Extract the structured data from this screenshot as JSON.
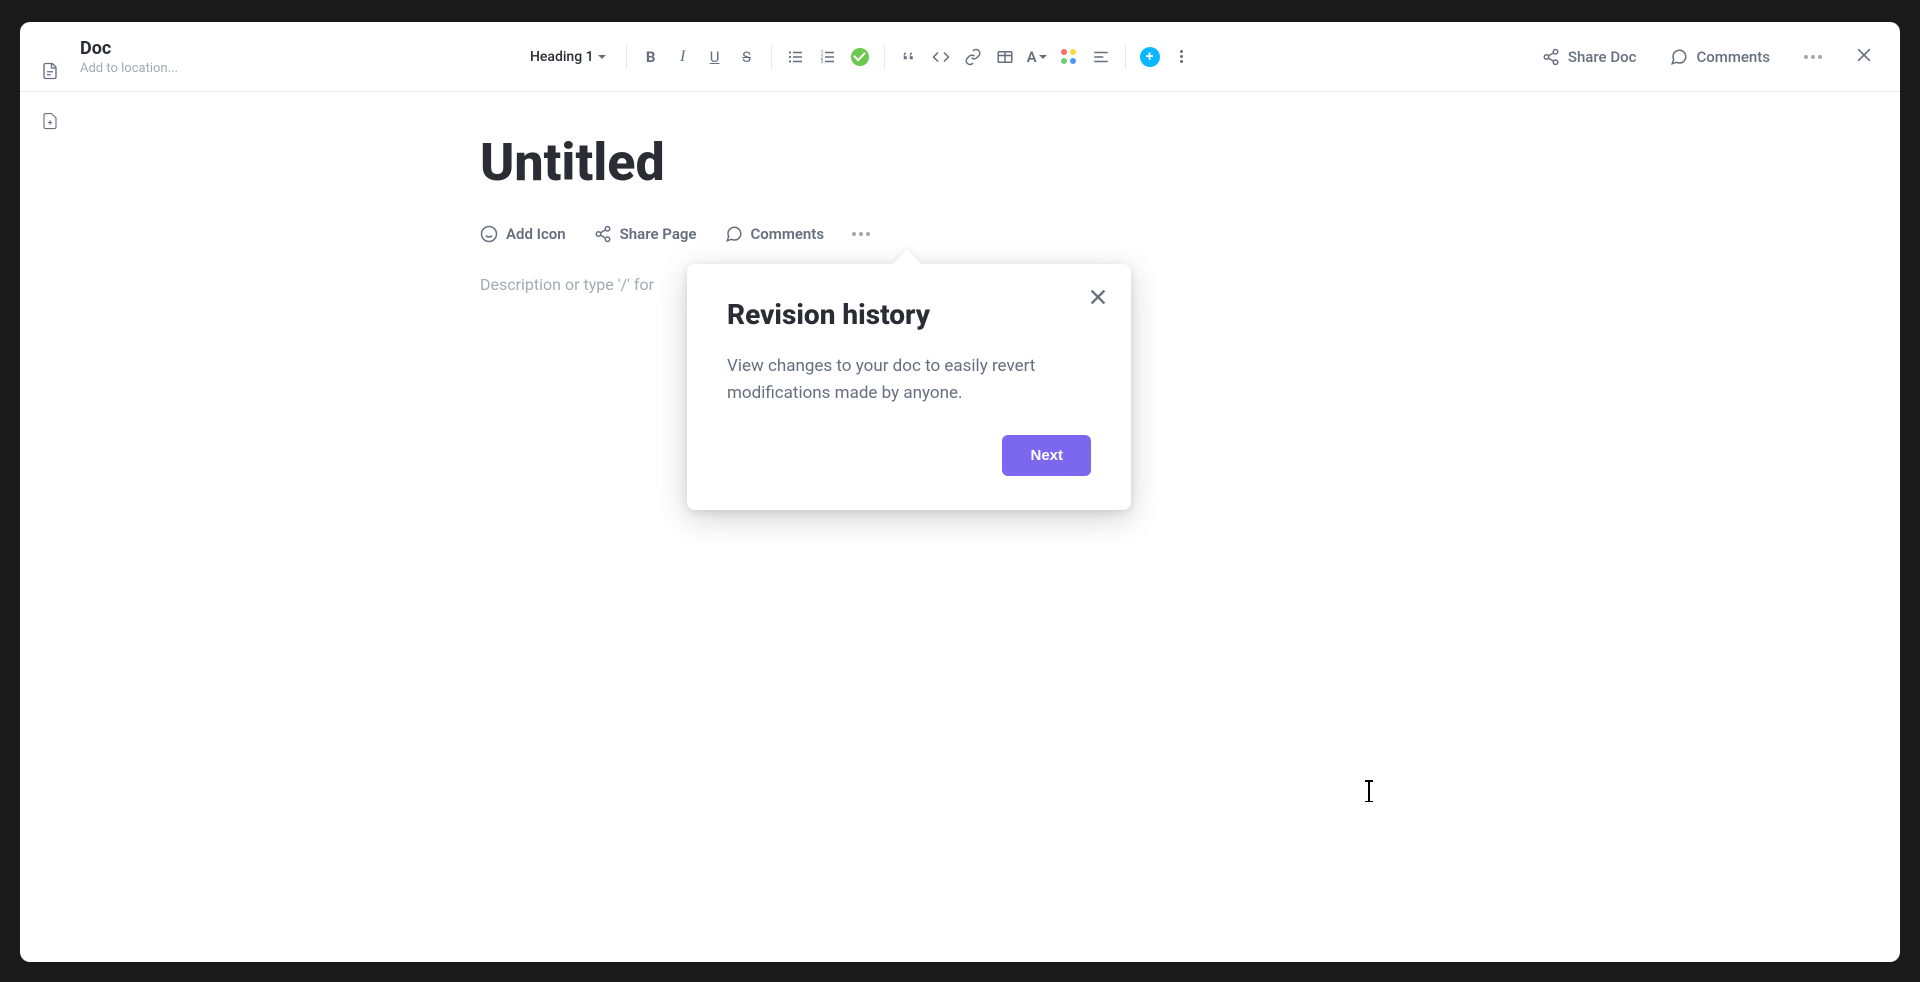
{
  "header": {
    "doc_label": "Doc",
    "location_placeholder": "Add to location...",
    "heading_selector": "Heading 1",
    "share_doc": "Share Doc",
    "comments": "Comments"
  },
  "doc": {
    "title": "Untitled",
    "description_placeholder": "Description or type '/' for"
  },
  "page_actions": {
    "add_icon": "Add Icon",
    "share_page": "Share Page",
    "comments": "Comments"
  },
  "popover": {
    "title": "Revision history",
    "body": "View changes to your doc to easily revert modifications made by anyone.",
    "next_label": "Next"
  },
  "colors": {
    "accent": "#7b68ee",
    "check_green": "#6bc950",
    "plus_blue": "#0ab6ff"
  }
}
